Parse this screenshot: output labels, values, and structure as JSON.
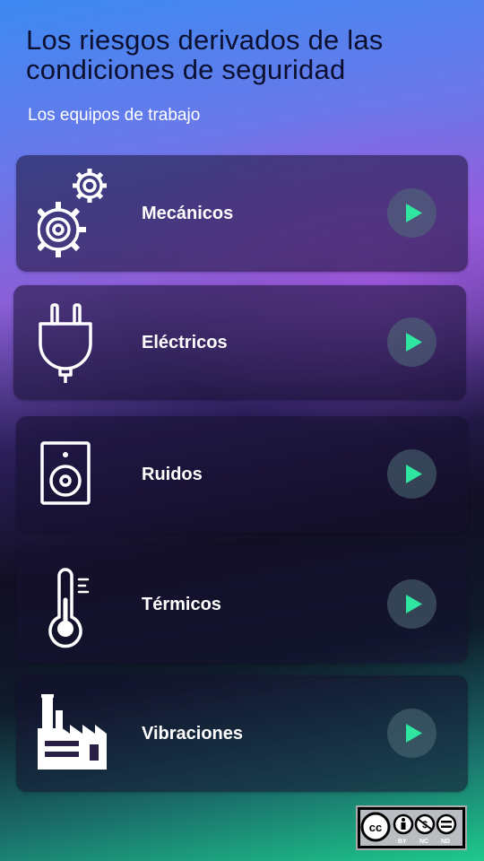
{
  "header": {
    "title": "Los riesgos derivados de las condiciones de seguridad",
    "subtitle": "Los equipos de trabajo"
  },
  "items": [
    {
      "label": "Mecánicos",
      "icon": "gears-icon"
    },
    {
      "label": "Eléctricos",
      "icon": "plug-icon"
    },
    {
      "label": "Ruidos",
      "icon": "speaker-icon"
    },
    {
      "label": "Térmicos",
      "icon": "thermometer-icon"
    },
    {
      "label": "Vibraciones",
      "icon": "factory-icon"
    }
  ],
  "play_color": "#2ee6a0",
  "license": {
    "cc": "cc",
    "by": "BY",
    "nc": "NC",
    "nd": "ND"
  }
}
